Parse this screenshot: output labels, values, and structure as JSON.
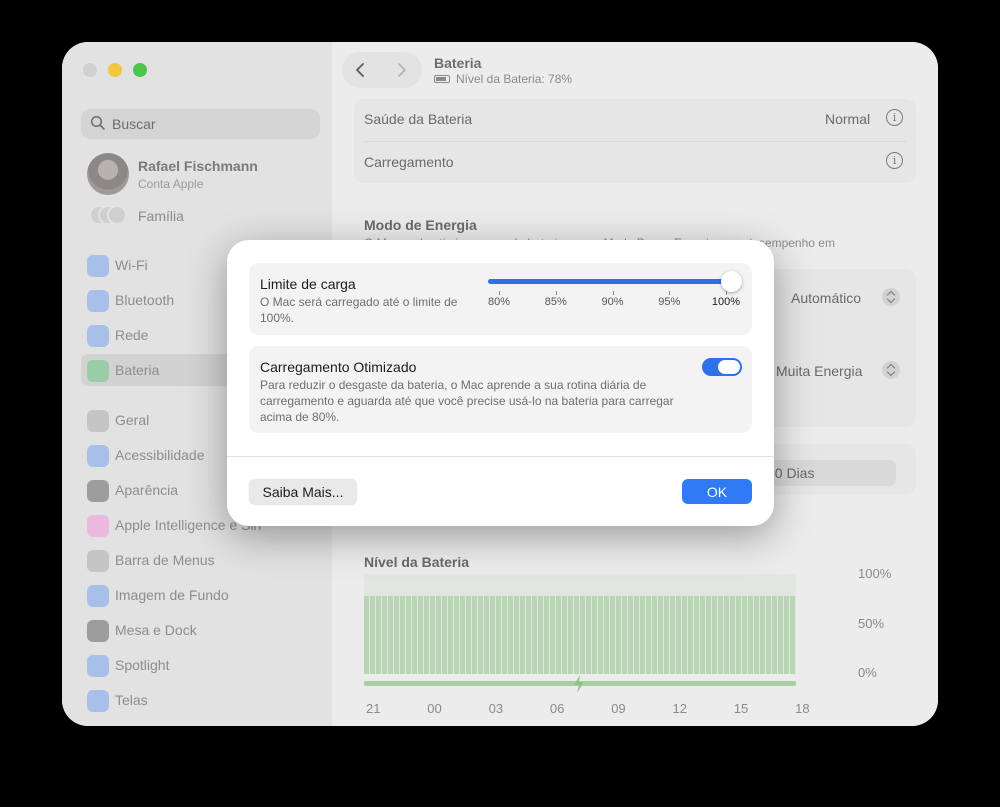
{
  "window": {
    "search_placeholder": "Buscar",
    "profile": {
      "name": "Rafael Fischmann",
      "subtitle": "Conta Apple"
    },
    "family_label": "Família",
    "sidebar_items": [
      {
        "label": "Wi-Fi",
        "icon": "wifi-icon",
        "color": "#3b82f6"
      },
      {
        "label": "Bluetooth",
        "icon": "bluetooth-icon",
        "color": "#3b82f6"
      },
      {
        "label": "Rede",
        "icon": "globe-icon",
        "color": "#3b82f6"
      },
      {
        "label": "Bateria",
        "icon": "battery-icon",
        "color": "#34c759",
        "selected": true
      },
      {
        "label": "Geral",
        "icon": "gear-icon",
        "color": "#8e8e93"
      },
      {
        "label": "Acessibilidade",
        "icon": "accessibility-icon",
        "color": "#3b82f6"
      },
      {
        "label": "Aparência",
        "icon": "appearance-icon",
        "color": "#1d1d1f"
      },
      {
        "label": "Apple Intelligence e Siri",
        "icon": "siri-icon",
        "color": "#ff6ad5"
      },
      {
        "label": "Barra de Menus",
        "icon": "menubar-icon",
        "color": "#8e8e93"
      },
      {
        "label": "Imagem de Fundo",
        "icon": "wallpaper-icon",
        "color": "#3b82f6"
      },
      {
        "label": "Mesa e Dock",
        "icon": "dock-icon",
        "color": "#1d1d1f"
      },
      {
        "label": "Spotlight",
        "icon": "spotlight-icon",
        "color": "#3b82f6"
      },
      {
        "label": "Telas",
        "icon": "display-icon",
        "color": "#3b82f6"
      }
    ]
  },
  "header": {
    "title": "Bateria",
    "subtitle": "Nível da Bateria: 78%"
  },
  "main": {
    "health_label": "Saúde da Bateria",
    "health_value": "Normal",
    "charging_label": "Carregamento",
    "energy_mode_title": "Modo de Energia",
    "energy_mode_desc": "O Mac pode otimizar o uso da bateria com o Modo Pouca Energia ou o desempenho em",
    "energy_value_1": "Automático",
    "energy_value_2": "Muita Energia",
    "range_tab": "10 Dias",
    "battery_level_title": "Nível da Bateria",
    "y_labels": [
      "100%",
      "50%",
      "0%"
    ],
    "x_labels": [
      "21",
      "00",
      "03",
      "06",
      "09",
      "12",
      "15",
      "18"
    ]
  },
  "dialog": {
    "charge_limit": {
      "title": "Limite de carga",
      "description": "O Mac será carregado até o limite de 100%.",
      "ticks": [
        "80%",
        "85%",
        "90%",
        "95%",
        "100%"
      ],
      "value": 100
    },
    "optimized": {
      "title": "Carregamento Otimizado",
      "description": "Para reduzir o desgaste da bateria, o Mac aprende a sua rotina diária de carregamento e aguarda até que você precise usá-lo na bateria para carregar acima de 80%.",
      "enabled": true
    },
    "learn_more": "Saiba Mais...",
    "ok": "OK"
  },
  "colors": {
    "accent": "#2f7bf5",
    "chart_green": "#b9d5b6"
  }
}
